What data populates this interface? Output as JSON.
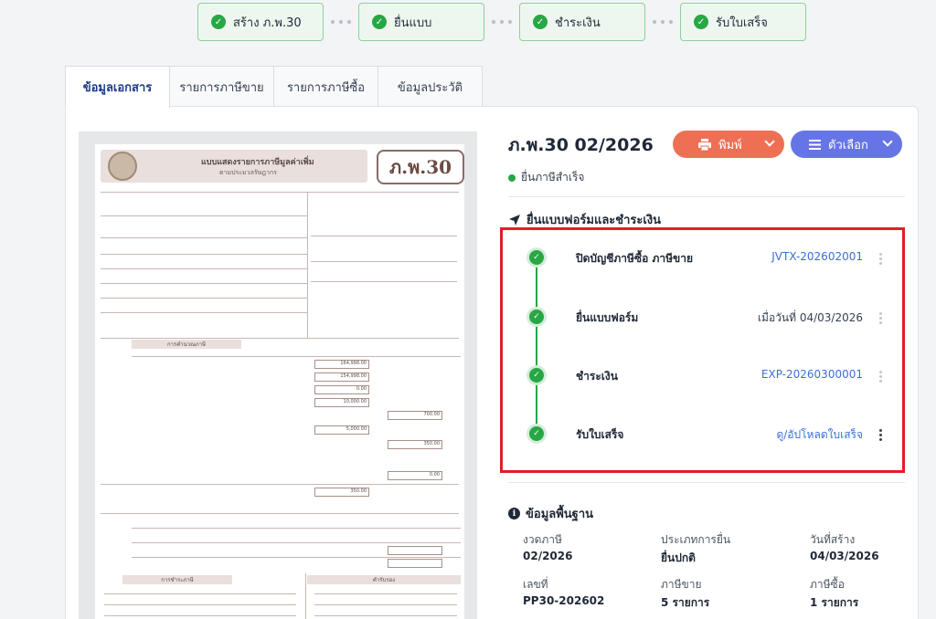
{
  "stepper": [
    {
      "label": "สร้าง ภ.พ.30"
    },
    {
      "label": "ยื่นแบบ"
    },
    {
      "label": "ชำระเงิน"
    },
    {
      "label": "รับใบเสร็จ"
    }
  ],
  "tabs": [
    {
      "label": "ข้อมูลเอกสาร",
      "active": true
    },
    {
      "label": "รายการภาษีขาย"
    },
    {
      "label": "รายการภาษีซื้อ"
    },
    {
      "label": "ข้อมูลประวัติ"
    }
  ],
  "preview": {
    "form_code": "ภ.พ.30",
    "title": "แบบแสดงรายการภาษีมูลค่าเพิ่ม",
    "subtitle": "ตามประมวลรัษฎากร",
    "section_calc": "การคำนวณภาษี",
    "section_pay": "การชำระภาษี",
    "section_cert": "คำรับรอง",
    "values": [
      "164,998.00",
      "154,998.00",
      "0.00",
      "10,000.00",
      "700.00",
      "5,000.00",
      "350.00",
      "0.00",
      "350.00"
    ]
  },
  "document": {
    "title": "ภ.พ.30 02/2026",
    "status": "ยื่นภาษีสำเร็จ",
    "print_label": "พิมพ์",
    "options_label": "ตัวเลือก"
  },
  "timeline": {
    "title": "ยื่นแบบฟอร์มและชำระเงิน",
    "items": [
      {
        "label": "ปิดบัญชีภาษีซื้อ ภาษีขาย",
        "value": "JVTX-202602001"
      },
      {
        "label": "ยื่นแบบฟอร์ม",
        "value": "เมื่อวันที่ 04/03/2026"
      },
      {
        "label": "ชำระเงิน",
        "value": "EXP-20260300001"
      },
      {
        "label": "รับใบเสร็จ",
        "value": "ดู/อัปโหลดใบเสร็จ"
      }
    ]
  },
  "info": {
    "title": "ข้อมูลพื้นฐาน",
    "fields": [
      {
        "label": "งวดภาษี",
        "value": "02/2026"
      },
      {
        "label": "ประเภทการยื่น",
        "value": "ยื่นปกติ"
      },
      {
        "label": "วันที่สร้าง",
        "value": "04/03/2026"
      },
      {
        "label": "เลขที่",
        "value": "PP30-202602"
      },
      {
        "label": "ภาษีขาย",
        "value": "5 รายการ"
      },
      {
        "label": "ภาษีซื้อ",
        "value": "1 รายการ"
      }
    ]
  },
  "colors": {
    "success": "#28a745",
    "print_button": "#ef6f55",
    "options_button": "#6675e6",
    "highlight_border": "#e01f26",
    "link": "#3b6fd8"
  }
}
